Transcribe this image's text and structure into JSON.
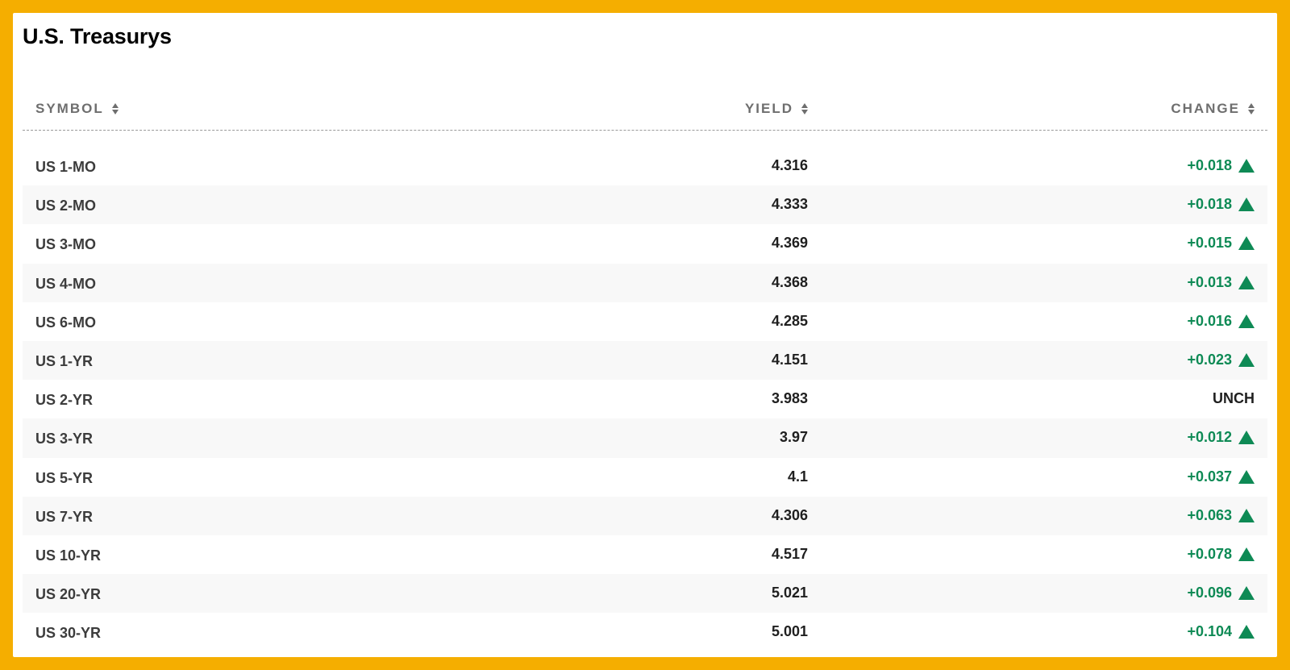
{
  "title": "U.S. Treasurys",
  "columns": {
    "symbol": "SYMBOL",
    "yield": "YIELD",
    "change": "CHANGE"
  },
  "colors": {
    "border": "#f5ae00",
    "up": "#0e8a55",
    "row_alt": "#f8f8f8"
  },
  "rows": [
    {
      "symbol": "US 1-MO",
      "yield": "4.316",
      "change": "+0.018",
      "direction": "up"
    },
    {
      "symbol": "US 2-MO",
      "yield": "4.333",
      "change": "+0.018",
      "direction": "up"
    },
    {
      "symbol": "US 3-MO",
      "yield": "4.369",
      "change": "+0.015",
      "direction": "up"
    },
    {
      "symbol": "US 4-MO",
      "yield": "4.368",
      "change": "+0.013",
      "direction": "up"
    },
    {
      "symbol": "US 6-MO",
      "yield": "4.285",
      "change": "+0.016",
      "direction": "up"
    },
    {
      "symbol": "US 1-YR",
      "yield": "4.151",
      "change": "+0.023",
      "direction": "up"
    },
    {
      "symbol": "US 2-YR",
      "yield": "3.983",
      "change": "UNCH",
      "direction": "flat"
    },
    {
      "symbol": "US 3-YR",
      "yield": "3.97",
      "change": "+0.012",
      "direction": "up"
    },
    {
      "symbol": "US 5-YR",
      "yield": "4.1",
      "change": "+0.037",
      "direction": "up"
    },
    {
      "symbol": "US 7-YR",
      "yield": "4.306",
      "change": "+0.063",
      "direction": "up"
    },
    {
      "symbol": "US 10-YR",
      "yield": "4.517",
      "change": "+0.078",
      "direction": "up"
    },
    {
      "symbol": "US 20-YR",
      "yield": "5.021",
      "change": "+0.096",
      "direction": "up"
    },
    {
      "symbol": "US 30-YR",
      "yield": "5.001",
      "change": "+0.104",
      "direction": "up"
    }
  ]
}
